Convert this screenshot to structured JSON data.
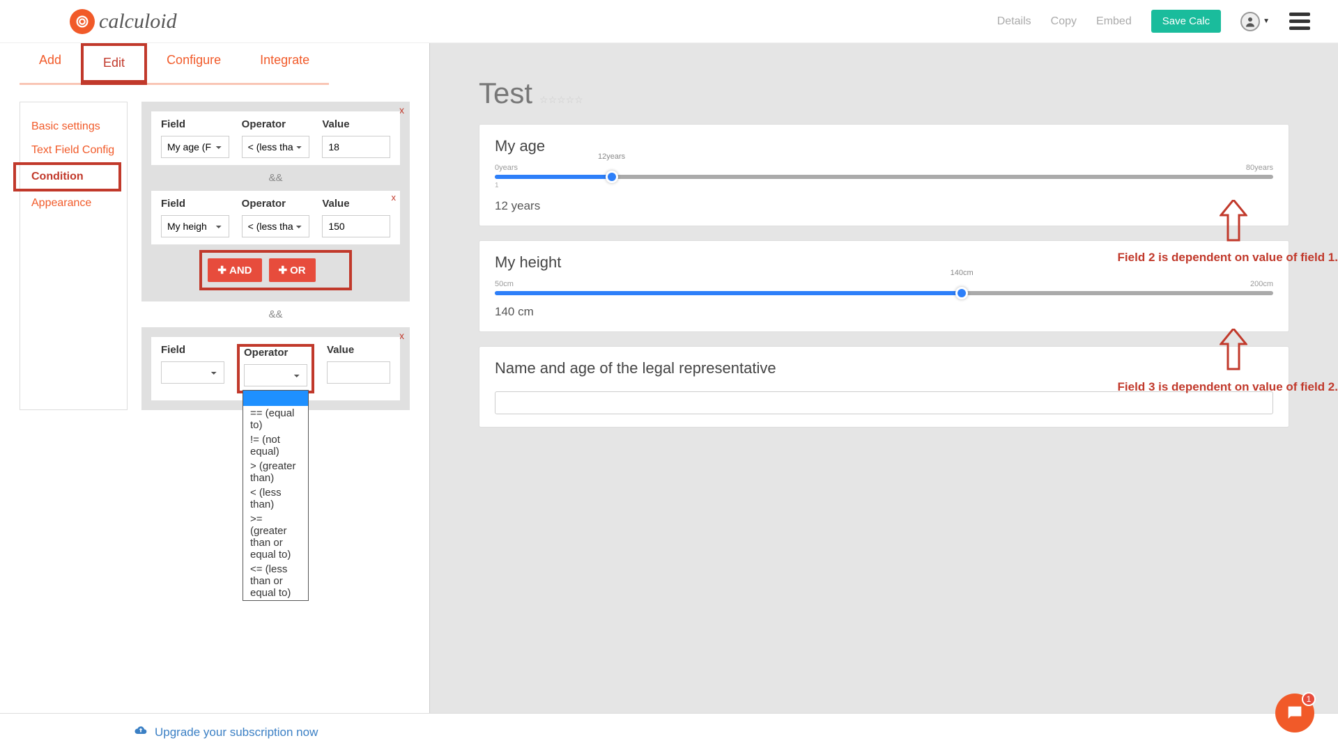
{
  "header": {
    "brand": "calculoid",
    "links": {
      "details": "Details",
      "copy": "Copy",
      "embed": "Embed"
    },
    "save_btn": "Save Calc"
  },
  "tabs": {
    "add": "Add",
    "edit": "Edit",
    "configure": "Configure",
    "integrate": "Integrate"
  },
  "sidenav": {
    "basic": "Basic settings",
    "textfield": "Text Field Config",
    "condition": "Condition",
    "appearance": "Appearance"
  },
  "cond": {
    "field_label": "Field",
    "operator_label": "Operator",
    "value_label": "Value",
    "close_x": "x",
    "and_sep": "&&",
    "row1": {
      "field": "My age (F",
      "operator": "< (less tha",
      "value": "18"
    },
    "row2": {
      "field": "My heigh",
      "operator": "< (less tha",
      "value": "150"
    },
    "btn_and": "AND",
    "btn_or": "OR",
    "row3": {
      "field": "",
      "operator": "",
      "value": ""
    },
    "dropdown_opts": {
      "eq": "== (equal to)",
      "ne": "!= (not equal)",
      "gt": "> (greater than)",
      "lt": "< (less than)",
      "ge": ">= (greater than or equal to)",
      "le": "<= (less than or equal to)"
    }
  },
  "preview": {
    "title": "Test",
    "age": {
      "title": "My age",
      "min_label": "0years",
      "cur_label": "12years",
      "max_label": "80years",
      "min_tick": "1",
      "result": "12  years",
      "pct": 15
    },
    "height": {
      "title": "My height",
      "min_label": "50cm",
      "cur_label": "140cm",
      "max_label": "200cm",
      "result": "140  cm",
      "pct": 60
    },
    "legal": {
      "title": "Name and age of the legal representative"
    },
    "annot1": "Field 2 is dependent on value of field 1.",
    "annot2": "Field 3 is dependent on value of field 2."
  },
  "footer": {
    "upgrade": "Upgrade your subscription now"
  },
  "chat": {
    "badge": "1"
  }
}
